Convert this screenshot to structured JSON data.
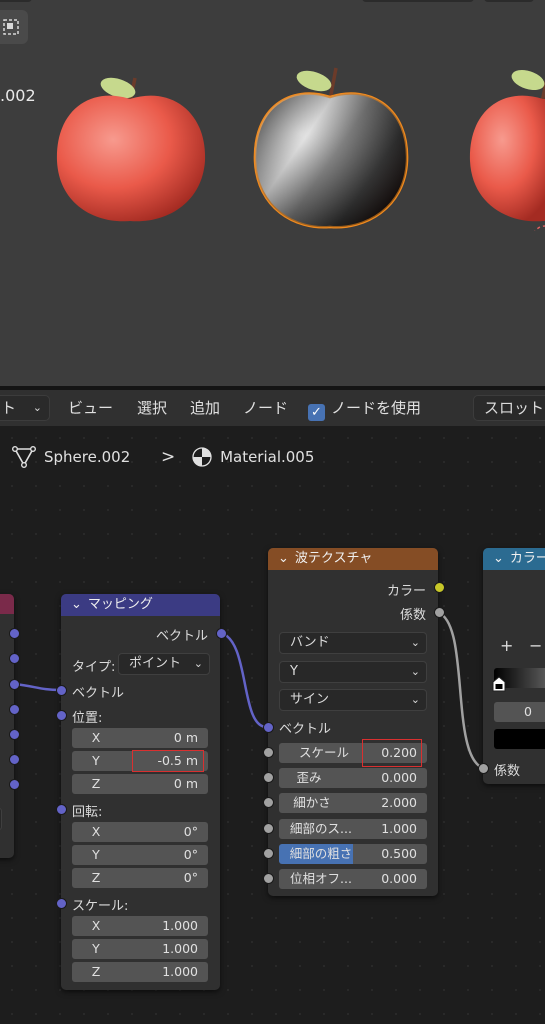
{
  "viewport": {
    "object_label": ".002",
    "select_icon": "select-box-icon"
  },
  "header": {
    "mode_dropdown": "ト",
    "menu": [
      "ビュー",
      "選択",
      "追加",
      "ノード"
    ],
    "use_nodes_label": "ノードを使用",
    "use_nodes_checked": true,
    "slot_label": "スロット"
  },
  "breadcrumb": {
    "object_icon": "mesh-object-icon",
    "object": "Sphere.002",
    "separator": ">",
    "material_icon": "material-icon",
    "material": "Material.005"
  },
  "mapping_node": {
    "title": "マッピング",
    "output_vector": "ベクトル",
    "type_label": "タイプ:",
    "type_value": "ポイント",
    "input_vector": "ベクトル",
    "location_label": "位置:",
    "location": [
      {
        "axis": "X",
        "value": "0 m"
      },
      {
        "axis": "Y",
        "value": "-0.5 m"
      },
      {
        "axis": "Z",
        "value": "0 m"
      }
    ],
    "rotation_label": "回転:",
    "rotation": [
      {
        "axis": "X",
        "value": "0°"
      },
      {
        "axis": "Y",
        "value": "0°"
      },
      {
        "axis": "Z",
        "value": "0°"
      }
    ],
    "scale_label": "スケール:",
    "scale": [
      {
        "axis": "X",
        "value": "1.000"
      },
      {
        "axis": "Y",
        "value": "1.000"
      },
      {
        "axis": "Z",
        "value": "1.000"
      }
    ]
  },
  "wave_node": {
    "title": "波テクスチャ",
    "output_color": "カラー",
    "output_factor": "係数",
    "type_dropdown": "バンド",
    "direction_dropdown": "Y",
    "profile_dropdown": "サイン",
    "input_vector": "ベクトル",
    "fields": [
      {
        "label": "スケール",
        "value": "0.200"
      },
      {
        "label": "歪み",
        "value": "0.000"
      },
      {
        "label": "細かさ",
        "value": "2.000"
      },
      {
        "label": "細部のス...",
        "value": "1.000"
      },
      {
        "label": "細部の粗さ",
        "value": "0.500"
      },
      {
        "label": "位相オフ...",
        "value": "0.000"
      }
    ]
  },
  "colorramp_node": {
    "title": "カラー",
    "add_label": "+",
    "remove_label": "−",
    "position_value": "0",
    "input_factor": "係数"
  },
  "colors": {
    "mapping_header": "#3b3b83",
    "wave_header": "#854d25",
    "colorramp_header": "#2b6b91",
    "left_node_header": "#7a2a4a",
    "selected_outline": "#f08a1e",
    "highlight_box": "#d93030",
    "checkbox": "#4772b3"
  }
}
